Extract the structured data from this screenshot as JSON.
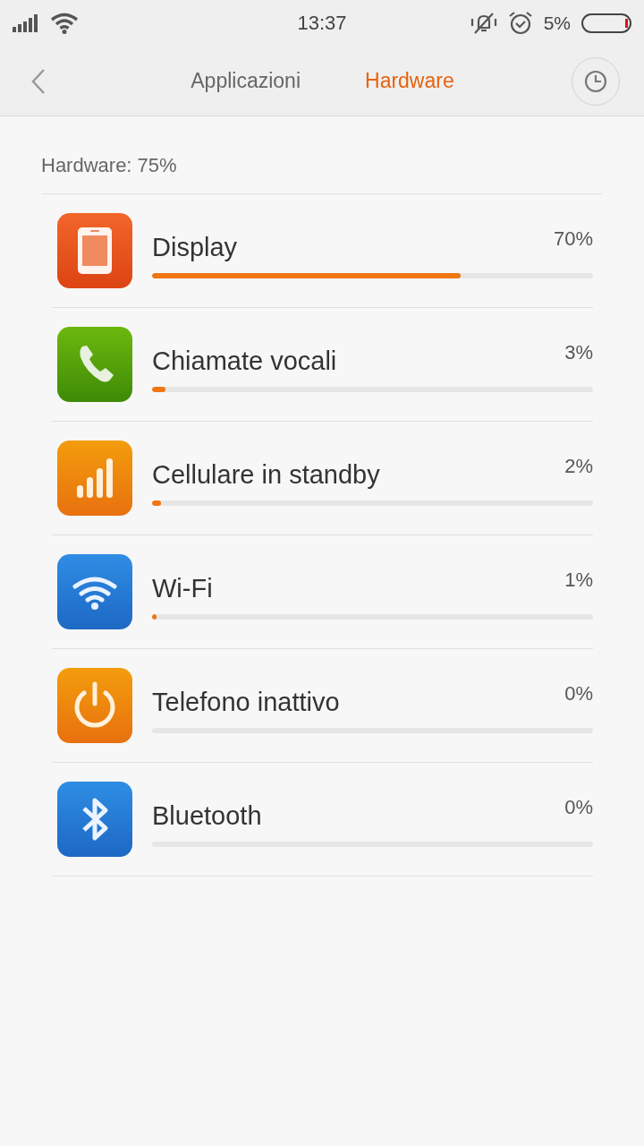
{
  "status_bar": {
    "time": "13:37",
    "battery_percent": "5%"
  },
  "tabs": [
    {
      "label": "Applicazioni",
      "selected": false
    },
    {
      "label": "Hardware",
      "selected": true
    }
  ],
  "summary": "Hardware: 75%",
  "items": [
    {
      "name": "Display",
      "percent": "70%",
      "level": 0.7,
      "kind": "display"
    },
    {
      "name": "Chiamate vocali",
      "percent": "3%",
      "level": 0.03,
      "kind": "phone"
    },
    {
      "name": "Cellulare in standby",
      "percent": "2%",
      "level": 0.02,
      "kind": "signal"
    },
    {
      "name": "Wi-Fi",
      "percent": "1%",
      "level": 0.01,
      "kind": "wifi"
    },
    {
      "name": "Telefono inattivo",
      "percent": "0%",
      "level": 0,
      "kind": "power"
    },
    {
      "name": "Bluetooth",
      "percent": "0%",
      "level": 0,
      "kind": "bluetooth"
    }
  ]
}
